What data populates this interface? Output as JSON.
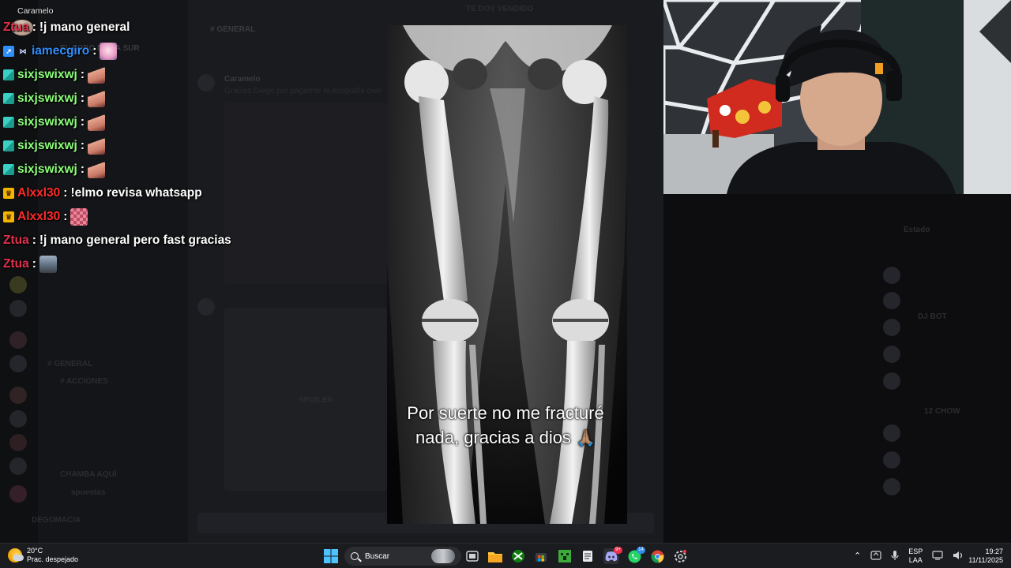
{
  "discord_bg": {
    "title": "TE DOY VENDIDO",
    "channel_header": "# GENERAL",
    "server_name": "EL LOBO DE LA SUR",
    "message_author": "Caramelo",
    "message_text": "Gracias Diego por pagarme la ecografía owo",
    "spoiler_label": "SPOILER",
    "channel_general": "# GENERAL",
    "channel_acciones": "# ACCIONES",
    "channel_chamba": "CHAMBA AQUÍ",
    "channel_apuestas": "apuestas",
    "user_footer": "DEGOMACIA",
    "right_labels": [
      "Estado",
      "DJ BOT",
      "12 CHOW"
    ]
  },
  "subtitle": {
    "line1": "Por suerte no me fracturé",
    "line2": "nada, gracias a dios",
    "emoji": "🙏🏽"
  },
  "chat": {
    "reply_context": "Caramelo",
    "messages": [
      {
        "user": "Ztua",
        "color": "#e0304c",
        "badge": "none",
        "text": "!j mano general",
        "emote": ""
      },
      {
        "user": "iamecgiro",
        "color": "#2f8fff",
        "badge": "prime",
        "text": "",
        "emote": "pink"
      },
      {
        "user": "sixjswixwj",
        "color": "#8cff7a",
        "badge": "sub",
        "text": "",
        "emote": "hand"
      },
      {
        "user": "sixjswixwj",
        "color": "#8cff7a",
        "badge": "sub",
        "text": "",
        "emote": "hand"
      },
      {
        "user": "sixjswixwj",
        "color": "#8cff7a",
        "badge": "sub",
        "text": "",
        "emote": "hand"
      },
      {
        "user": "sixjswixwj",
        "color": "#8cff7a",
        "badge": "sub",
        "text": "",
        "emote": "hand"
      },
      {
        "user": "sixjswixwj",
        "color": "#8cff7a",
        "badge": "sub",
        "text": "",
        "emote": "hand"
      },
      {
        "user": "Alxxl30",
        "color": "#ff2a2a",
        "badge": "crown",
        "text": "!elmo revisa whatsapp",
        "emote": ""
      },
      {
        "user": "Alxxl30",
        "color": "#ff2a2a",
        "badge": "crown",
        "text": "",
        "emote": "pixel"
      },
      {
        "user": "Ztua",
        "color": "#e0304c",
        "badge": "none",
        "text": "!j mano general pero fast gracias",
        "emote": ""
      },
      {
        "user": "Ztua",
        "color": "#e0304c",
        "badge": "none",
        "text": "",
        "emote": "photo"
      }
    ]
  },
  "taskbar": {
    "weather_temp": "20°C",
    "weather_desc": "Prac. despejado",
    "search_label": "Buscar",
    "language_line1": "ESP",
    "language_line2": "LAA",
    "time": "19:27",
    "date": "11/11/2025",
    "discord_badge": "9+",
    "whatsapp_badge": "14"
  },
  "colors": {
    "chat_sub_badge": "#3ad0c4",
    "chat_crown_badge": "#f4b400",
    "chat_prime_badge": "#2f8fff"
  }
}
